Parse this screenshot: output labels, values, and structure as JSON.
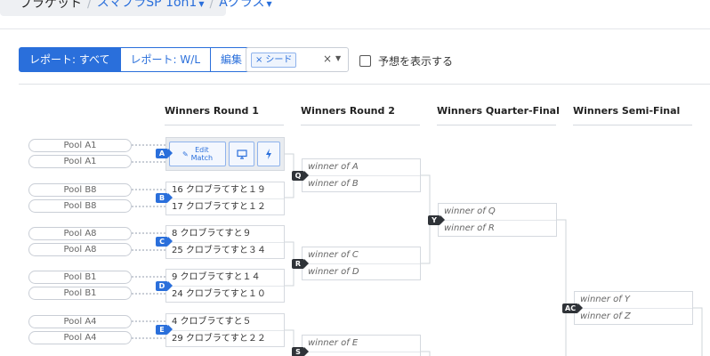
{
  "breadcrumb": {
    "root": "ブラケット",
    "items": [
      "スマブラSP 1on1",
      "Aクラス"
    ]
  },
  "report_buttons": [
    {
      "label": "レポート: すべて",
      "active": true
    },
    {
      "label": "レポート: W/L",
      "active": false
    },
    {
      "label": "編集",
      "active": false
    }
  ],
  "seed_filter": {
    "chip_label": "シード"
  },
  "show_predictions": {
    "label": "予想を表示する",
    "checked": false
  },
  "rounds": [
    "Winners Round 1",
    "Winners Round 2",
    "Winners Quarter-Final",
    "Winners Semi-Final"
  ],
  "pools": [
    {
      "top": "Pool A1",
      "bottom": "Pool A1"
    },
    {
      "top": "Pool B8",
      "bottom": "Pool B8"
    },
    {
      "top": "Pool A8",
      "bottom": "Pool A8"
    },
    {
      "top": "Pool B1",
      "bottom": "Pool B1"
    },
    {
      "top": "Pool A4",
      "bottom": "Pool A4"
    }
  ],
  "match_actions": {
    "edit_label": "Edit\nMatch"
  },
  "round1": [
    {
      "badge": "A",
      "top": "",
      "bottom": ""
    },
    {
      "badge": "B",
      "top": "16 クロブラてすと１９",
      "bottom": "17 クロブラてすと１２"
    },
    {
      "badge": "C",
      "top": "8 クロブラてすと９",
      "bottom": "25 クロブラてすと３４"
    },
    {
      "badge": "D",
      "top": "9 クロブラてすと１４",
      "bottom": "24 クロブラてすと１０"
    },
    {
      "badge": "E",
      "top": "4 クロブラてすと５",
      "bottom": "29 クロブラてすと２２"
    }
  ],
  "round2": [
    {
      "badge": "Q",
      "top": "winner of A",
      "bottom": "winner of B"
    },
    {
      "badge": "R",
      "top": "winner of C",
      "bottom": "winner of D"
    },
    {
      "badge": "S",
      "top": "winner of E",
      "bottom": ""
    }
  ],
  "quarter": [
    {
      "badge": "Y",
      "top": "winner of Q",
      "bottom": "winner of R"
    }
  ],
  "semi": [
    {
      "badge": "AC",
      "top": "winner of Y",
      "bottom": "winner of Z"
    }
  ],
  "colors": {
    "accent": "#2a6fdb",
    "badge_dark": "#2f3338"
  }
}
